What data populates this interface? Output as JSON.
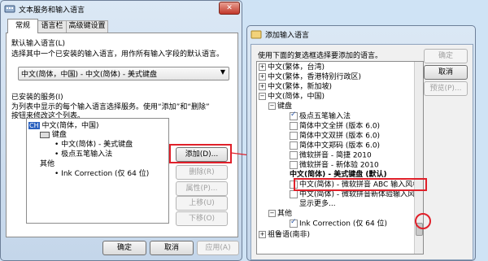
{
  "left_dialog": {
    "title": "文本服务和输入语言",
    "tabs": [
      "常规",
      "语言栏",
      "高级键设置"
    ],
    "default_lang_heading": "默认输入语言(L)",
    "default_lang_desc": "选择其中一个已安装的输入语言，用作所有输入字段的默认语言。",
    "default_lang_value": "中文(简体，中国) - 中文(简体) - 美式键盘",
    "services_heading": "已安装的服务(I)",
    "services_desc_1": "为列表中显示的每个输入语言选择服务。使用“添加”和“删除”",
    "services_desc_2": "按钮来修改这个列表。",
    "tree": {
      "lang_badge": "CH",
      "lang": "中文(简体，中国)",
      "keyboard": "键盘",
      "kb_item1": "• 中文(简体) - 美式键盘",
      "kb_item2": "• 极点五笔输入法",
      "other": "其他",
      "other_item": "• Ink Correction (仅 64 位)"
    },
    "buttons": {
      "add": "添加(D)...",
      "remove": "删除(R)",
      "properties": "属性(P)...",
      "up": "上移(U)",
      "down": "下移(O)",
      "ok": "确定",
      "cancel": "取消",
      "apply": "应用(A)"
    }
  },
  "right_dialog": {
    "title": "添加输入语言",
    "desc": "使用下面的复选框选择要添加的语言。",
    "buttons": {
      "ok": "确定",
      "cancel": "取消",
      "preview": "预览(P)..."
    },
    "tree": {
      "r1": "中文(繁体，台湾)",
      "r2": "中文(繁体，香港特别行政区)",
      "r3": "中文(繁体，新加坡)",
      "r4": "中文(简体，中国)",
      "r5": "键盘",
      "k1": "极点五笔输入法",
      "k2": "简体中文全拼 (版本 6.0)",
      "k3": "简体中文双拼 (版本 6.0)",
      "k4": "简体中文郑码 (版本 6.0)",
      "k5": "微软拼音 - 简捷 2010",
      "k6": "微软拼音 - 新体验 2010",
      "k7": "中文(简体) - 美式键盘 (默认)",
      "k8": "中文(简体) - 微软拼音 ABC 输入风格",
      "k9": "中文(简体) - 微软拼音新体验输入风格",
      "k10": "显示更多...",
      "o1": "其他",
      "o2": "Ink Correction (仅 64 位)",
      "r6": "祖鲁语(南非)"
    }
  },
  "colors": {
    "highlight_red": "#e0202a",
    "badge_blue": "#2b62c0"
  }
}
